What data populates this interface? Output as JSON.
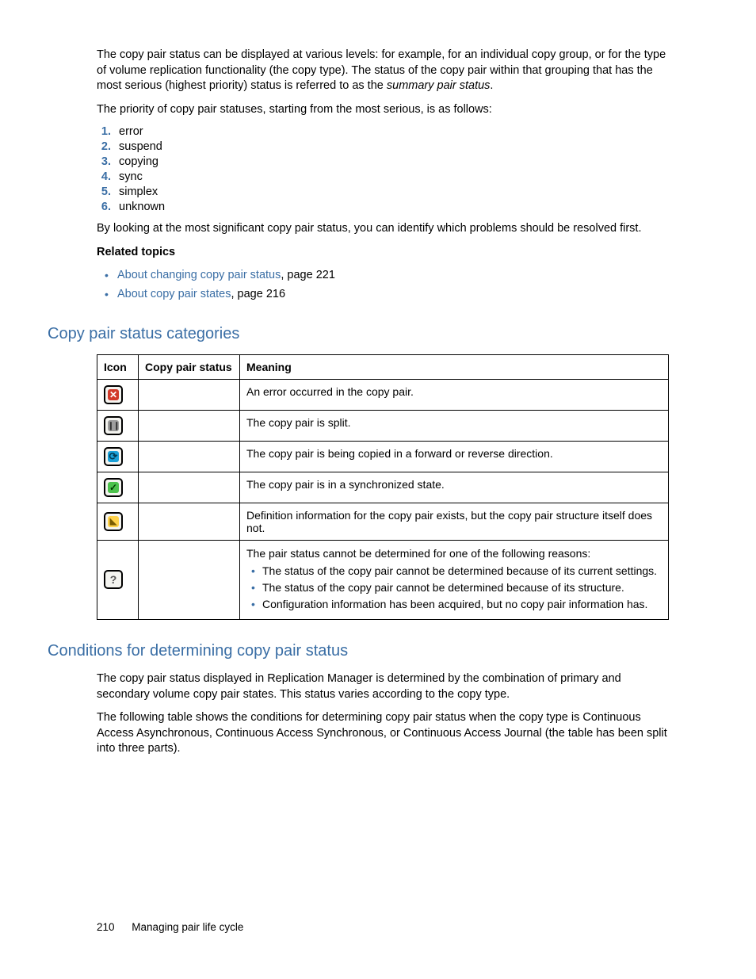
{
  "intro": {
    "p1a": "The copy pair status can be displayed at various levels: for example, for an individual copy group, or for the type of volume replication functionality (the copy type). The status of the copy pair within that grouping that has the most serious (highest priority) status is referred to as the ",
    "p1_em": "summary pair status",
    "p1b": ".",
    "p2": "The priority of copy pair statuses, starting from the most serious, is as follows:"
  },
  "priority_list": [
    "error",
    "suspend",
    "copying",
    "sync",
    "simplex",
    "unknown"
  ],
  "after_list": "By looking at the most significant copy pair status, you can identify which problems should be resolved first.",
  "related": {
    "heading": "Related topics",
    "items": [
      {
        "link": "About changing copy pair status",
        "suffix": ", page 221"
      },
      {
        "link": "About copy pair states",
        "suffix": ", page 216"
      }
    ]
  },
  "section1": {
    "title": "Copy pair status categories",
    "headers": {
      "icon": "Icon",
      "status": "Copy pair status",
      "meaning": "Meaning"
    },
    "rows": [
      {
        "icon": "error",
        "status": "",
        "meaning": "An error occurred in the copy pair."
      },
      {
        "icon": "suspend",
        "status": "",
        "meaning": "The copy pair is split."
      },
      {
        "icon": "copying",
        "status": "",
        "meaning": "The copy pair is being copied in a forward or reverse direction."
      },
      {
        "icon": "sync",
        "status": "",
        "meaning": "The copy pair is in a synchronized state."
      },
      {
        "icon": "simplex",
        "status": "",
        "meaning": "Definition information for the copy pair exists, but the copy pair structure itself does not."
      }
    ],
    "row_unknown": {
      "icon": "unknown",
      "status": "",
      "lead": "The pair status cannot be determined for one of the following reasons:",
      "bullets": [
        "The status of the copy pair cannot be determined because of its current settings.",
        "The status of the copy pair cannot be determined because of its structure.",
        "Configuration information has been acquired, but no copy pair information has."
      ]
    }
  },
  "section2": {
    "title": "Conditions for determining copy pair status",
    "p1": "The copy pair status displayed in Replication Manager is determined by the combination of primary and secondary volume copy pair states. This status varies according to the copy type.",
    "p2": "The following table shows the conditions for determining copy pair status when the copy type is Continuous Access Asynchronous, Continuous Access Synchronous, or Continuous Access Journal (the table has been split into three parts)."
  },
  "footer": {
    "page": "210",
    "chapter": "Managing pair life cycle"
  }
}
